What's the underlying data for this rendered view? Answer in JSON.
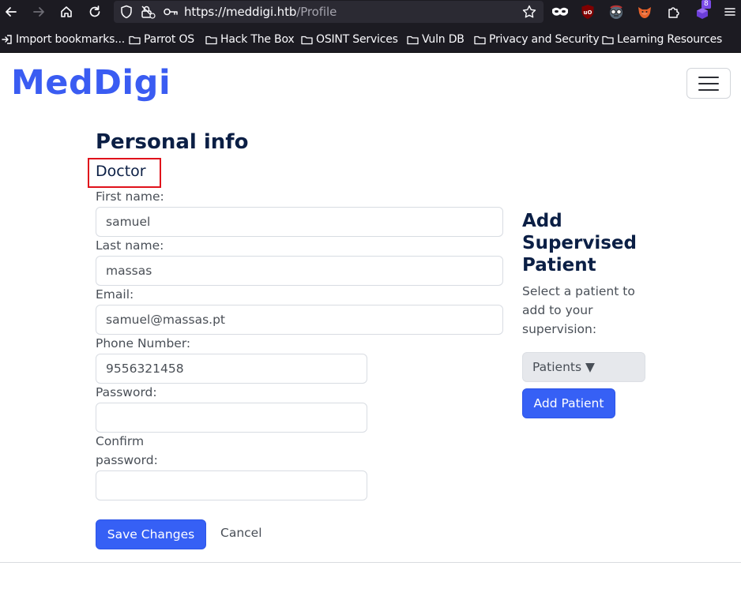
{
  "browser": {
    "url_host": "https://meddigi.htb",
    "url_path": "/Profile",
    "extension_badge": "8",
    "bookmarks": [
      "Import bookmarks...",
      "Parrot OS",
      "Hack The Box",
      "OSINT Services",
      "Vuln DB",
      "Privacy and Security",
      "Learning Resources"
    ]
  },
  "navbar": {
    "brand": "MedDigi"
  },
  "profile": {
    "title": "Personal info",
    "role": "Doctor",
    "fields": {
      "first_name": {
        "label": "First name:",
        "value": "samuel"
      },
      "last_name": {
        "label": "Last name:",
        "value": "massas"
      },
      "email": {
        "label": "Email:",
        "value": "samuel@massas.pt"
      },
      "phone": {
        "label": "Phone Number:",
        "value": "9556321458"
      },
      "password": {
        "label": "Password:",
        "value": ""
      },
      "confirm_password": {
        "label_line1": "Confirm",
        "label_line2": "password:",
        "value": ""
      }
    },
    "save_label": "Save Changes",
    "cancel_label": "Cancel"
  },
  "supervise": {
    "title_line1": "Add",
    "title_line2": "Supervised",
    "title_line3": "Patient",
    "text_line1": "Select a patient to",
    "text_line2": "add to your",
    "text_line3": "supervision:",
    "dropdown_label": "Patients ▼",
    "add_label": "Add Patient"
  },
  "colors": {
    "brand": "#3a5cf2",
    "primary_button": "#3660f5",
    "heading": "#0b1f45",
    "highlight_box": "#e0121b"
  }
}
